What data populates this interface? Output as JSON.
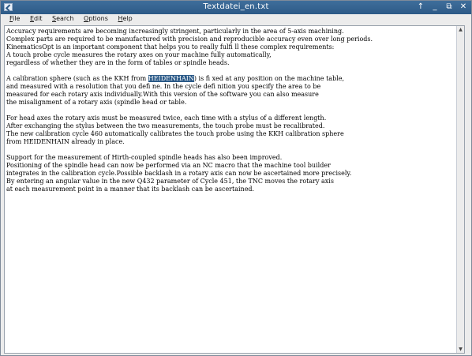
{
  "window": {
    "title": "Textdatei_en.txt",
    "controls": {
      "up": "↑",
      "minimize": "_",
      "restore": "⧉",
      "close": "✕"
    }
  },
  "menu": [
    {
      "label": "File"
    },
    {
      "label": "Edit"
    },
    {
      "label": "Search"
    },
    {
      "label": "Options"
    },
    {
      "label": "Help"
    }
  ],
  "editor": {
    "lines": [
      "Accuracy requirements are becoming increasingly stringent, particularly in the area of 5-axis machining.",
      "Complex parts are required to be manufactured with precision and reproducible accuracy even over long periods.",
      "KinematicsOpt is an important component that helps you to really fulfi ll these complex requirements:",
      "A touch probe cycle measures the rotary axes on your machine fully automatically,",
      "regardless of whether they are in the form of tables or spindle heads.",
      "",
      {
        "before": "A calibration sphere (such as the KKH from ",
        "selected": "HEIDENHAIN",
        "after": ") is fi xed at any position on the machine table,"
      },
      "and measured with a resolution that you defi ne. In the cycle defi nition you specify the area to be",
      "measured for each rotary axis individually.With this version of the software you can also measure",
      "the misalignment of a rotary axis (spindle head or table.",
      "",
      "For head axes the rotary axis must be measured twice, each time with a stylus of a different length.",
      "After exchanging the stylus between the two measurements, the touch probe must be recalibrated.",
      "The new calibration cycle 460 automatically calibrates the touch probe using the KKH calibration sphere",
      "from HEIDENHAIN already in place.",
      "",
      "Support for the measurement of Hirth-coupled spindle heads has also been improved.",
      "Positioning of the spindle head can now be performed via an NC macro that the machine tool builder",
      "integrates in the calibration cycle.Possible backlash in a rotary axis can now be ascertained more precisely.",
      "By entering an angular value in the new Q432 parameter of Cycle 451, the TNC moves the rotary axis",
      "at each measurement point in a manner that its backlash can be ascertained."
    ]
  }
}
